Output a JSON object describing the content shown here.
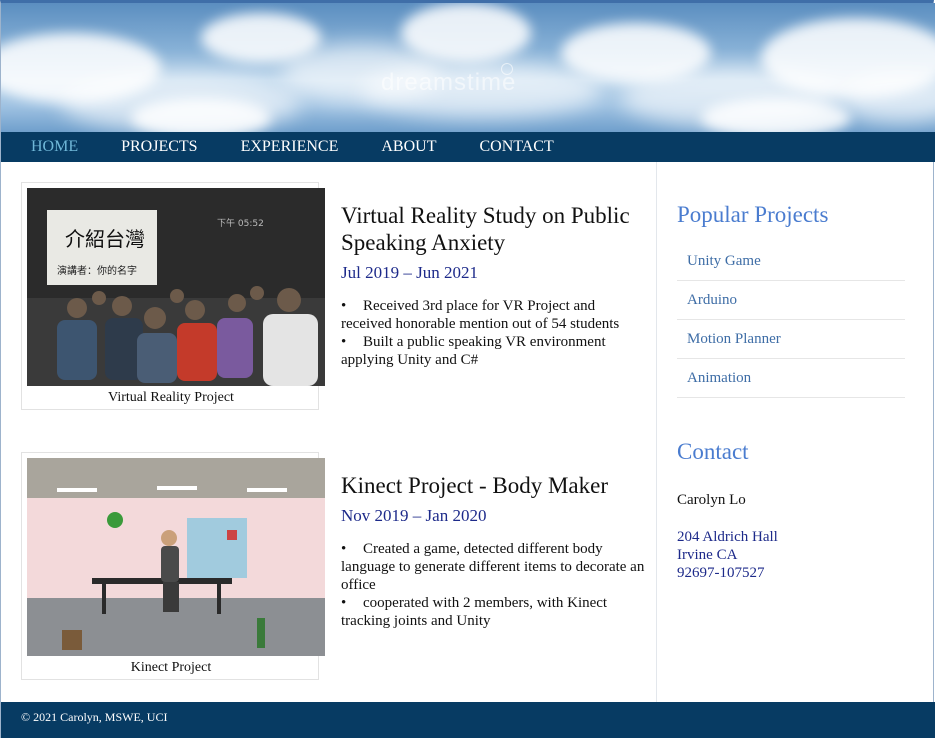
{
  "header": {
    "watermark": "dreamstime",
    "sky_colors": [
      "#5b8ec0",
      "#bcd6ec",
      "#ffffff"
    ]
  },
  "nav": {
    "items": [
      {
        "label": "HOME",
        "active": true
      },
      {
        "label": "PROJECTS",
        "active": false
      },
      {
        "label": "EXPERIENCE",
        "active": false
      },
      {
        "label": "ABOUT",
        "active": false
      },
      {
        "label": "CONTACT",
        "active": false
      }
    ],
    "bg_color": "#073b63",
    "active_color": "#6fb7d8"
  },
  "projects": [
    {
      "caption": "Virtual Reality Project",
      "title": "Virtual Reality Study on Public Speaking Anxiety",
      "date": "Jul 2019 – Jun 2021",
      "bullets": [
        "Received 3rd place for VR Project and received honorable mention out of 54 students",
        "Built a public speaking VR environment applying Unity and C#"
      ],
      "slide_text": "介紹台灣",
      "slide_subtext": "演講者：你的名字",
      "clock_text": "下午 05:52"
    },
    {
      "caption": "Kinect Project",
      "title": "Kinect Project - Body Maker",
      "date": "Nov 2019 – Jan 2020",
      "bullets": [
        "Created a game, detected different body language to generate different items to decorate an office",
        "cooperated with 2 members, with Kinect tracking joints and Unity"
      ]
    }
  ],
  "sidebar": {
    "popular_heading": "Popular Projects",
    "popular_items": [
      "Unity Game",
      "Arduino",
      "Motion Planner",
      "Animation"
    ],
    "contact_heading": "Contact",
    "contact_name": "Carolyn Lo",
    "address_lines": [
      "204 Aldrich Hall",
      "Irvine CA",
      "92697-107527"
    ]
  },
  "footer": {
    "text": "© 2021 Carolyn, MSWE, UCI"
  }
}
